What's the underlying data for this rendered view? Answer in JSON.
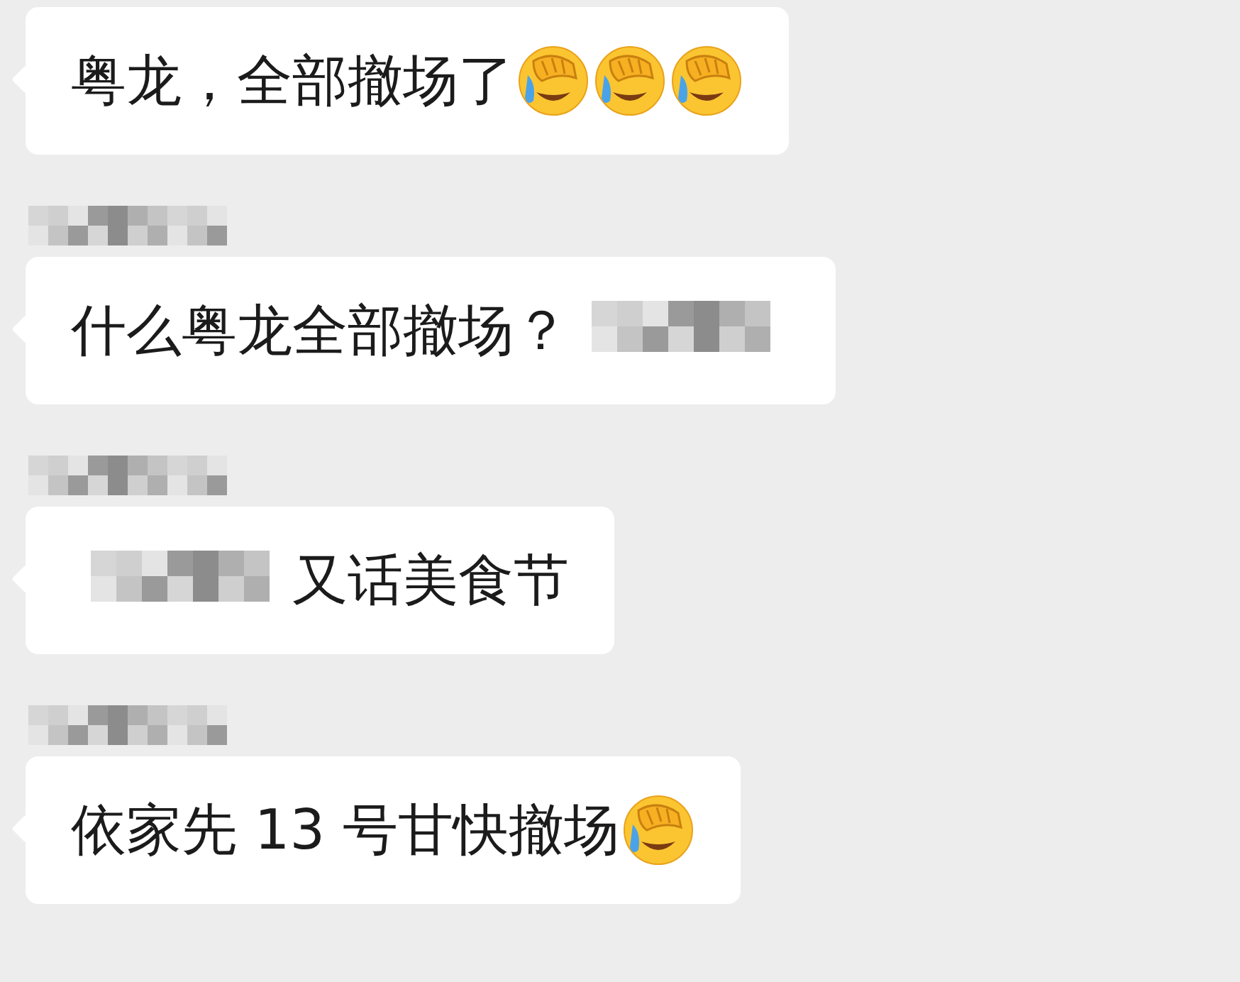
{
  "messages": [
    {
      "sender_mosaic": false,
      "parts": [
        {
          "kind": "text",
          "text": "粤龙，全部撤场了"
        },
        {
          "kind": "emoji"
        },
        {
          "kind": "emoji"
        },
        {
          "kind": "emoji"
        }
      ]
    },
    {
      "sender_mosaic": true,
      "parts": [
        {
          "kind": "text",
          "text": "什么粤龙全部撤场？"
        },
        {
          "kind": "mosaic"
        }
      ]
    },
    {
      "sender_mosaic": true,
      "parts": [
        {
          "kind": "mosaic"
        },
        {
          "kind": "text",
          "text": "又话美食节"
        }
      ]
    },
    {
      "sender_mosaic": true,
      "parts": [
        {
          "kind": "text",
          "text": "依家先 13 号甘快撤场"
        },
        {
          "kind": "emoji"
        }
      ]
    }
  ]
}
